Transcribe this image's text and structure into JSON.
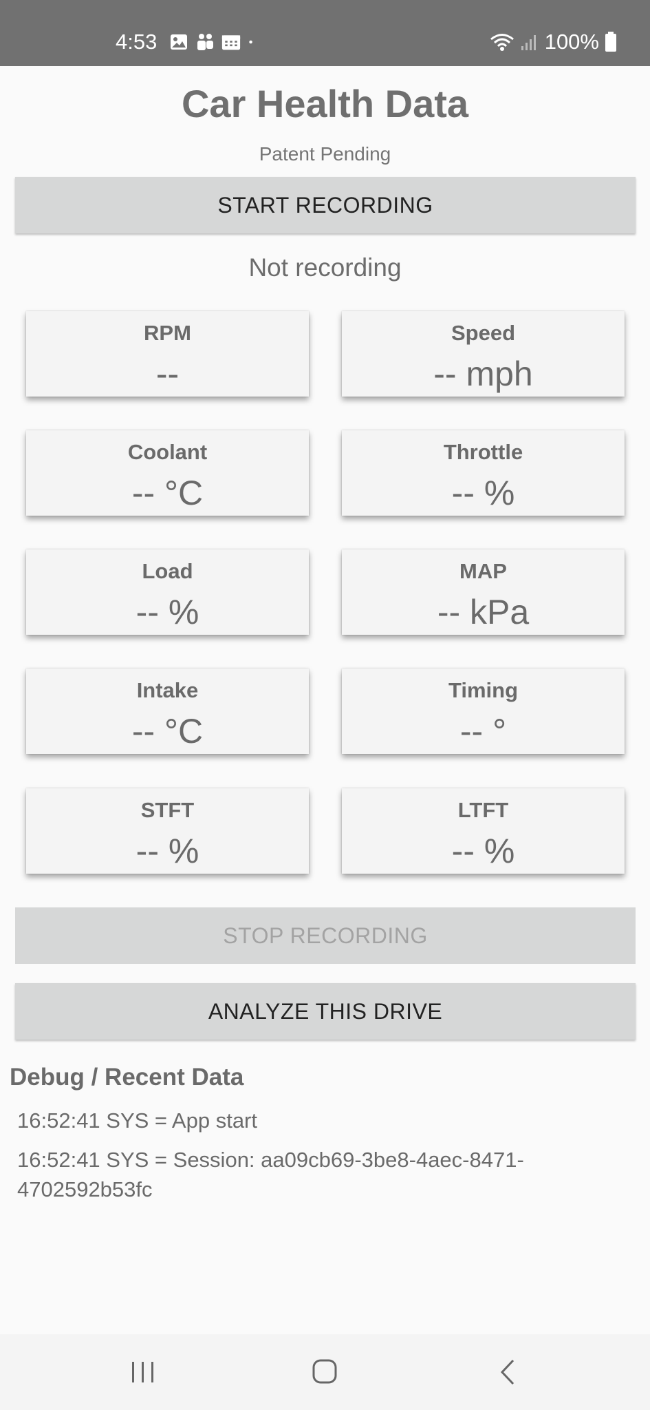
{
  "status_bar": {
    "time": "4:53",
    "battery": "100%",
    "icons": [
      "gallery-icon",
      "teams-icon",
      "calendar-icon",
      "dot-icon",
      "wifi-icon",
      "signal-icon",
      "battery-icon"
    ]
  },
  "app": {
    "title": "Car Health Data",
    "subtitle": "Patent Pending"
  },
  "buttons": {
    "start": "START RECORDING",
    "stop": "STOP RECORDING",
    "analyze": "ANALYZE THIS DRIVE"
  },
  "recording_status": "Not recording",
  "cards": [
    {
      "label": "RPM",
      "value": "--"
    },
    {
      "label": "Speed",
      "value": "-- mph"
    },
    {
      "label": "Coolant",
      "value": "-- °C"
    },
    {
      "label": "Throttle",
      "value": "-- %"
    },
    {
      "label": "Load",
      "value": "-- %"
    },
    {
      "label": "MAP",
      "value": "-- kPa"
    },
    {
      "label": "Intake",
      "value": "-- °C"
    },
    {
      "label": "Timing",
      "value": "-- °"
    },
    {
      "label": "STFT",
      "value": "-- %"
    },
    {
      "label": "LTFT",
      "value": "-- %"
    }
  ],
  "debug": {
    "title": "Debug / Recent Data",
    "lines": [
      "16:52:41  SYS = App start",
      "16:52:41  SYS = Session: aa09cb69-3be8-4aec-8471-4702592b53fc"
    ]
  },
  "colors": {
    "status_bar_bg": "#717171",
    "button_bg": "#d6d7d7",
    "card_bg": "#f4f4f4",
    "page_bg": "#fafafa"
  }
}
